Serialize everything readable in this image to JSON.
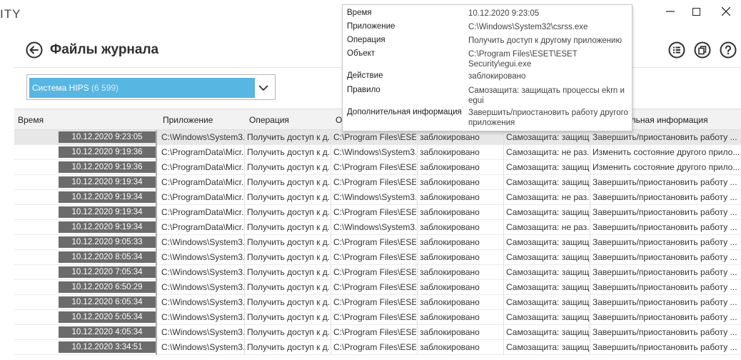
{
  "app": {
    "title_fragment": "ITY"
  },
  "header": {
    "title": "Файлы журнала"
  },
  "filter": {
    "label": "Система HIPS",
    "count": "(6 599)"
  },
  "columns": {
    "time": "Время",
    "app": "Приложение",
    "op": "Операция",
    "obj": "О",
    "info": "тельная информация"
  },
  "rows": [
    {
      "time": "10.12.2020 9:23:05",
      "app": "C:\\Windows\\System3...",
      "op": "Получить доступ к д...",
      "obj": "C:\\Program Files\\ESE...",
      "act": "заблокировано",
      "rule": "Самозащита: защищ...",
      "info": "Завершить/приостановить работу ..."
    },
    {
      "time": "10.12.2020 9:19:36",
      "app": "C:\\ProgramData\\Micr...",
      "op": "Получить доступ к д...",
      "obj": "C:\\Windows\\System3...",
      "act": "заблокировано",
      "rule": "Самозащита: не раз...",
      "info": "Изменить состояние другого прило..."
    },
    {
      "time": "10.12.2020 9:19:36",
      "app": "C:\\ProgramData\\Micr...",
      "op": "Получить доступ к д...",
      "obj": "C:\\Program Files\\ESE...",
      "act": "заблокировано",
      "rule": "Самозащита: защищ...",
      "info": "Изменить состояние другого прило..."
    },
    {
      "time": "10.12.2020 9:19:34",
      "app": "C:\\ProgramData\\Micr...",
      "op": "Получить доступ к д...",
      "obj": "C:\\Program Files\\ESE...",
      "act": "заблокировано",
      "rule": "Самозащита: защищ...",
      "info": "Завершить/приостановить работу ..."
    },
    {
      "time": "10.12.2020 9:19:34",
      "app": "C:\\ProgramData\\Micr...",
      "op": "Получить доступ к д...",
      "obj": "C:\\Windows\\System3...",
      "act": "заблокировано",
      "rule": "Самозащита: не раз...",
      "info": "Завершить/приостановить работу ..."
    },
    {
      "time": "10.12.2020 9:19:34",
      "app": "C:\\ProgramData\\Micr...",
      "op": "Получить доступ к д...",
      "obj": "C:\\Program Files\\ESE...",
      "act": "заблокировано",
      "rule": "Самозащита: защищ...",
      "info": "Завершить/приостановить работу ..."
    },
    {
      "time": "10.12.2020 9:19:34",
      "app": "C:\\ProgramData\\Micr...",
      "op": "Получить доступ к д...",
      "obj": "C:\\Windows\\System3...",
      "act": "заблокировано",
      "rule": "Самозащита: не раз...",
      "info": "Завершить/приостановить работу ..."
    },
    {
      "time": "10.12.2020 9:05:33",
      "app": "C:\\Windows\\System3...",
      "op": "Получить доступ к д...",
      "obj": "C:\\Program Files\\ESE...",
      "act": "заблокировано",
      "rule": "Самозащита: защищ...",
      "info": "Завершить/приостановить работу ..."
    },
    {
      "time": "10.12.2020 8:05:34",
      "app": "C:\\Windows\\System3...",
      "op": "Получить доступ к д...",
      "obj": "C:\\Program Files\\ESE...",
      "act": "заблокировано",
      "rule": "Самозащита: защищ...",
      "info": "Завершить/приостановить работу ..."
    },
    {
      "time": "10.12.2020 7:05:34",
      "app": "C:\\Windows\\System3...",
      "op": "Получить доступ к д...",
      "obj": "C:\\Program Files\\ESE...",
      "act": "заблокировано",
      "rule": "Самозащита: защищ...",
      "info": "Завершить/приостановить работу ..."
    },
    {
      "time": "10.12.2020 6:50:29",
      "app": "C:\\Windows\\System3...",
      "op": "Получить доступ к д...",
      "obj": "C:\\Program Files\\ESE...",
      "act": "заблокировано",
      "rule": "Самозащита: защищ...",
      "info": "Завершить/приостановить работу ..."
    },
    {
      "time": "10.12.2020 6:05:34",
      "app": "C:\\Windows\\System3...",
      "op": "Получить доступ к д...",
      "obj": "C:\\Program Files\\ESE...",
      "act": "заблокировано",
      "rule": "Самозащита: защищ...",
      "info": "Завершить/приостановить работу ..."
    },
    {
      "time": "10.12.2020 5:05:34",
      "app": "C:\\Windows\\System3...",
      "op": "Получить доступ к д...",
      "obj": "C:\\Program Files\\ESE...",
      "act": "заблокировано",
      "rule": "Самозащита: защищ...",
      "info": "Завершить/приостановить работу ..."
    },
    {
      "time": "10.12.2020 4:05:34",
      "app": "C:\\Windows\\System3...",
      "op": "Получить доступ к д...",
      "obj": "C:\\Program Files\\ESE...",
      "act": "заблокировано",
      "rule": "Самозащита: защищ...",
      "info": "Завершить/приостановить работу ..."
    },
    {
      "time": "10.12.2020 3:34:51",
      "app": "C:\\Windows\\System3...",
      "op": "Получить доступ к д...",
      "obj": "C:\\Program Files\\ESE...",
      "act": "заблокировано",
      "rule": "Самозащита: защищ...",
      "info": "Завершить/приостановить работу ..."
    }
  ],
  "tooltip": [
    {
      "label": "Время",
      "value": "10.12.2020 9:23:05"
    },
    {
      "label": "Приложение",
      "value": "C:\\Windows\\System32\\csrss.exe"
    },
    {
      "label": "Операция",
      "value": "Получить доступ к другому приложению"
    },
    {
      "label": "Объект",
      "value": "C:\\Program Files\\ESET\\ESET Security\\egui.exe"
    },
    {
      "label": "Действие",
      "value": "заблокировано"
    },
    {
      "label": "Правило",
      "value": "Самозащита: защищать процессы ekrn и egui"
    },
    {
      "label": "Дополнительная информация",
      "value": "Завершить/приостановить работу другого приложения"
    }
  ],
  "colors": {
    "accent": "#58b6e2",
    "time_cell": "#6b6b6b"
  }
}
